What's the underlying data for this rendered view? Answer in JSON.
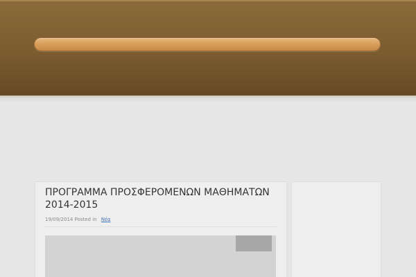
{
  "post": {
    "title": "ΠΡΟΓΡΑΜΜΑ ΠΡΟΣΦΕΡΟΜΕΝΩΝ ΜΑΘΗΜΑΤΩΝ 2014-2015",
    "date": "19/09/2014",
    "posted_in_label": "Posted in",
    "category": "Νέα"
  },
  "colors": {
    "header_brown": "#7a5c2f",
    "nav_bar_tan": "#d79d5a",
    "page_background": "#e6e6e6",
    "card_background": "#efefef",
    "link_blue": "#3d6fb6"
  }
}
